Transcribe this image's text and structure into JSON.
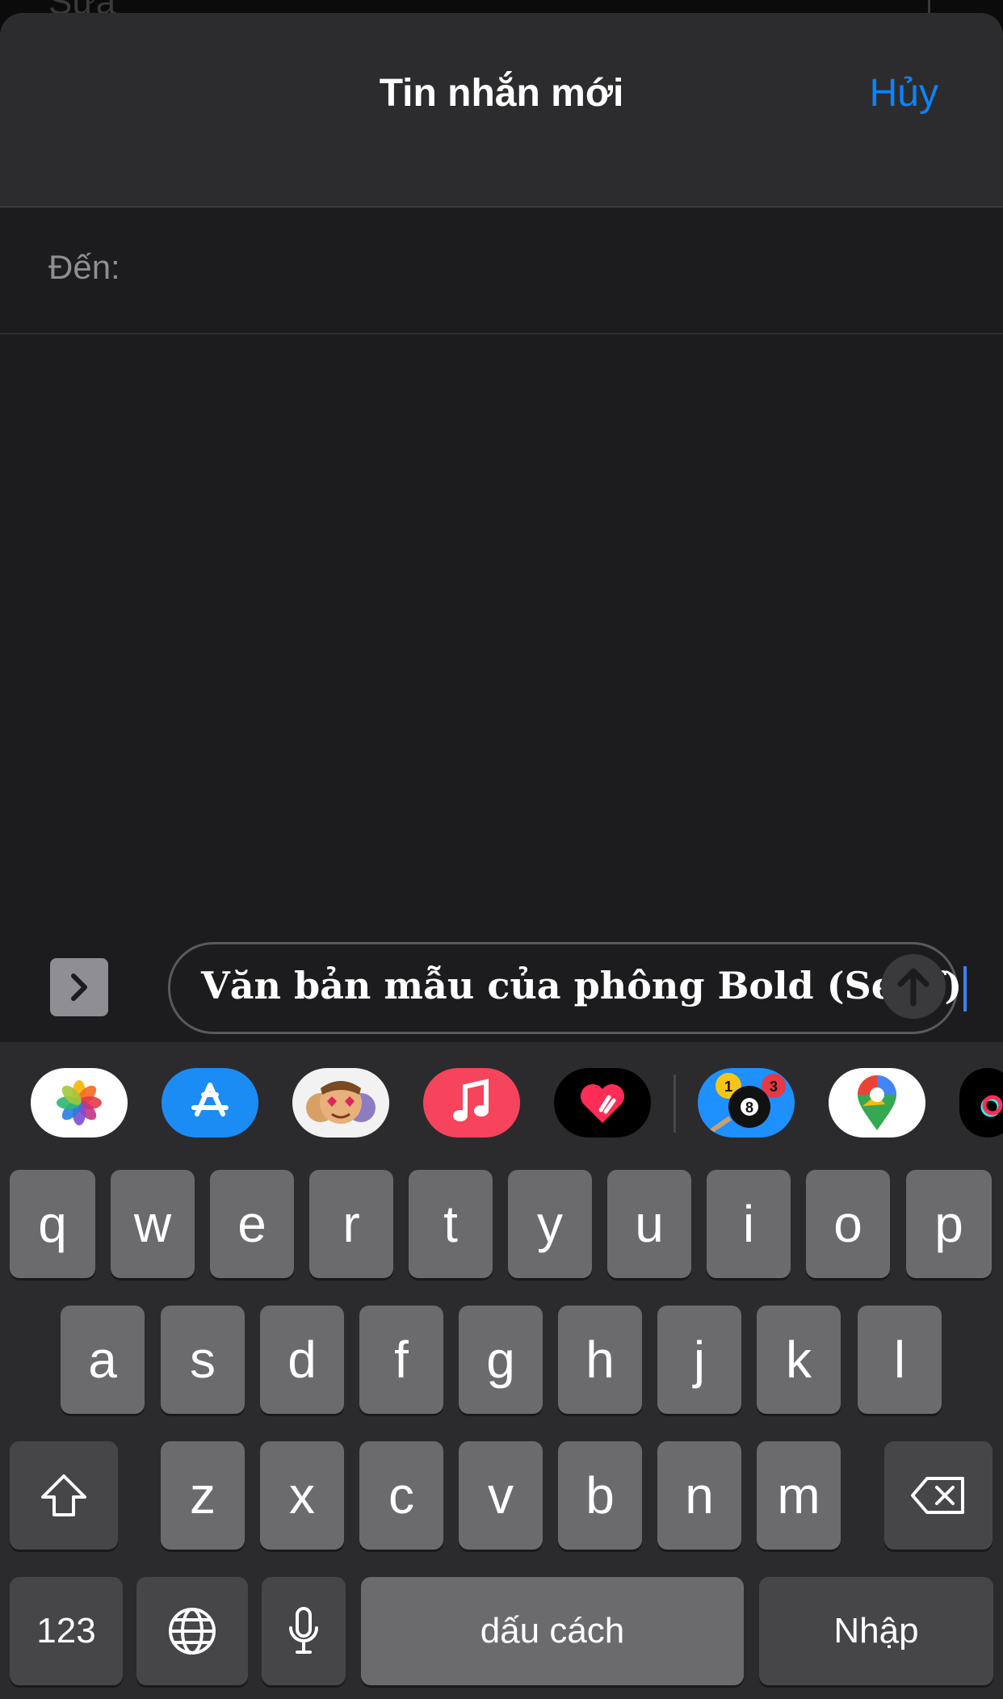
{
  "underlay": {
    "partial_text": "Sửa"
  },
  "nav": {
    "title": "Tin nhắn mới",
    "cancel_label": "Hủy"
  },
  "recipient": {
    "label": "Đến:"
  },
  "compose": {
    "message_text": "Văn bản mẫu của phông Bold (Serif)"
  },
  "app_strip": [
    {
      "name": "photos-app-icon"
    },
    {
      "name": "app-store-icon"
    },
    {
      "name": "memoji-icon"
    },
    {
      "name": "music-app-icon"
    },
    {
      "name": "digital-touch-icon"
    },
    {
      "name": "8-ball-pool-icon",
      "label_numbers": [
        "1",
        "8",
        "3"
      ]
    },
    {
      "name": "google-maps-icon"
    },
    {
      "name": "tiktok-icon"
    }
  ],
  "keyboard": {
    "row1": [
      "q",
      "w",
      "e",
      "r",
      "t",
      "y",
      "u",
      "i",
      "o",
      "p"
    ],
    "row2": [
      "a",
      "s",
      "d",
      "f",
      "g",
      "h",
      "j",
      "k",
      "l"
    ],
    "row3": [
      "z",
      "x",
      "c",
      "v",
      "b",
      "n",
      "m"
    ],
    "numbers_label": "123",
    "space_label": "dấu cách",
    "return_label": "Nhập"
  },
  "colors": {
    "accent": "#0a84ff",
    "background": "#1c1c1e",
    "key": "#6b6b6e",
    "key_dark": "#464649"
  }
}
